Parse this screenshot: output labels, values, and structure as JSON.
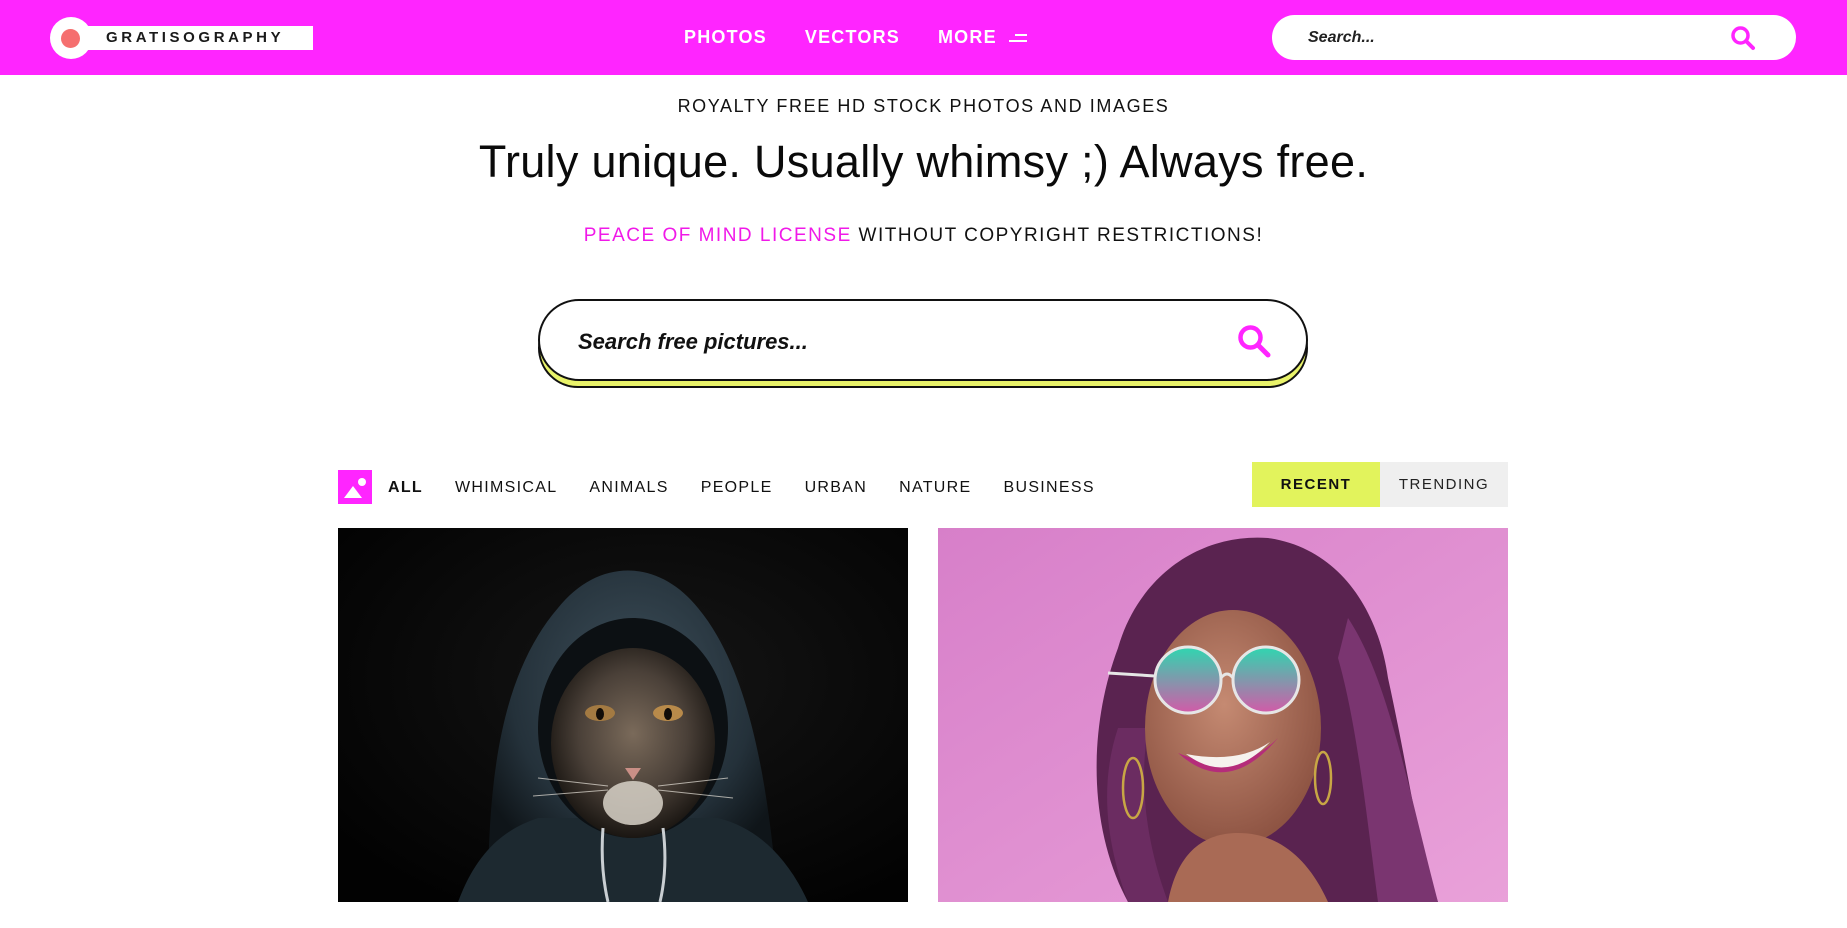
{
  "header": {
    "logo_text": "GRATISOGRAPHY",
    "nav": [
      {
        "label": "PHOTOS"
      },
      {
        "label": "VECTORS"
      },
      {
        "label": "MORE"
      }
    ],
    "search_placeholder": "Search..."
  },
  "hero": {
    "tagline": "ROYALTY FREE HD STOCK PHOTOS AND IMAGES",
    "headline": "Truly unique. Usually whimsy ;) Always free.",
    "license_link": "PEACE OF MIND LICENSE",
    "license_rest": " WITHOUT COPYRIGHT RESTRICTIONS!",
    "search_placeholder": "Search free pictures..."
  },
  "categories": [
    "ALL",
    "WHIMSICAL",
    "ANIMALS",
    "PEOPLE",
    "URBAN",
    "NATURE",
    "BUSINESS"
  ],
  "sort": {
    "recent": "RECENT",
    "trending": "TRENDING"
  },
  "colors": {
    "brand_pink": "#ff25ff",
    "accent_yellow": "#e2f35c"
  },
  "photos": [
    {
      "subject": "cat wearing hoodie"
    },
    {
      "subject": "smiling woman with sunglasses"
    }
  ]
}
